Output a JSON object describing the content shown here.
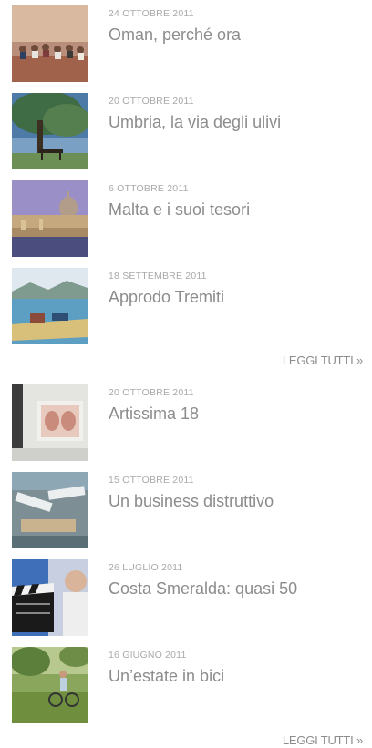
{
  "section1": {
    "items": [
      {
        "date": "24 OTTOBRE 2011",
        "title": "Oman, perché ora",
        "image": "oman-people-on-wall-photo"
      },
      {
        "date": "20 OTTOBRE 2011",
        "title": "Umbria, la via degli ulivi",
        "image": "olive-tree-bench-photo"
      },
      {
        "date": "6 OTTOBRE 2011",
        "title": "Malta e i suoi tesori",
        "image": "malta-skyline-photo"
      },
      {
        "date": "18 SETTEMBRE 2011",
        "title": "Approdo Tremiti",
        "image": "tremiti-boat-photo"
      }
    ],
    "more_label": "LEGGI TUTTI »"
  },
  "section2": {
    "items": [
      {
        "date": "20 OTTOBRE 2011",
        "title": "Artissima 18",
        "image": "art-gallery-photo"
      },
      {
        "date": "15 OTTOBRE 2011",
        "title": "Un business distruttivo",
        "image": "cruise-ships-port-photo"
      },
      {
        "date": "26 LUGLIO 2011",
        "title": "Costa Smeralda: quasi 50",
        "image": "clapperboard-photo"
      },
      {
        "date": "16 GIUGNO 2011",
        "title": "Un’estate in bici",
        "image": "cyclist-field-photo"
      }
    ],
    "more_label": "LEGGI TUTTI »"
  }
}
